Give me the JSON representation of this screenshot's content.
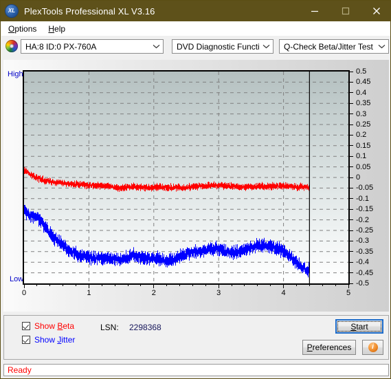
{
  "window": {
    "title": "PlexTools Professional XL V3.16",
    "icon": "XL",
    "icon_name": "plextools-logo-icon",
    "minimize": "minimize-icon",
    "maximize": "maximize-icon",
    "close": "close-icon",
    "titlebar_color": "#5e511a"
  },
  "menu": {
    "items": [
      {
        "label": "Options",
        "accel": "O"
      },
      {
        "label": "Help",
        "accel": "H"
      }
    ]
  },
  "toolbar": {
    "drive_icon": "optical-disc-icon",
    "drive_select": {
      "value": "HA:8 ID:0  PX-760A",
      "options": [
        "HA:8 ID:0  PX-760A"
      ]
    },
    "function_select": {
      "value": "DVD Diagnostic Functions",
      "options": [
        "DVD Diagnostic Functions"
      ]
    },
    "test_select": {
      "value": "Q-Check Beta/Jitter Test",
      "options": [
        "Q-Check Beta/Jitter Test"
      ]
    }
  },
  "chart_data": {
    "type": "line",
    "title": "",
    "xlabel": "",
    "ylabel": "",
    "xlim": [
      0,
      5
    ],
    "ylim": [
      -0.5,
      0.5
    ],
    "xticks": [
      0,
      1,
      2,
      3,
      4,
      5
    ],
    "yticks": [
      0.5,
      0.45,
      0.4,
      0.35,
      0.3,
      0.25,
      0.2,
      0.15,
      0.1,
      0.05,
      0,
      -0.05,
      -0.1,
      -0.15,
      -0.2,
      -0.25,
      -0.3,
      -0.35,
      -0.4,
      -0.45,
      -0.5
    ],
    "ytick_labels": [
      "0.5",
      "0.45",
      "0.4",
      "0.35",
      "0.3",
      "0.25",
      "0.2",
      "0.15",
      "0.1",
      "0.05",
      "0",
      "-0.05",
      "-0.1",
      "-0.15",
      "-0.2",
      "-0.25",
      "-0.3",
      "-0.35",
      "-0.4",
      "-0.45",
      "-0.5"
    ],
    "left_axis_top_label": "High",
    "left_axis_bottom_label": "Low",
    "grid": true,
    "grid_style": "dashed",
    "grid_color": "#808080",
    "plot_bg_gradient_top": "#b4c0c0",
    "plot_bg_gradient_bottom": "#ffffff",
    "data_end_marker_x": 4.4,
    "legend_position": "below-plot",
    "series": [
      {
        "name": "Beta",
        "color": "#ff0000",
        "noise": 0.016,
        "x": [
          0.0,
          0.05,
          0.1,
          0.18,
          0.28,
          0.4,
          0.55,
          0.7,
          0.9,
          1.1,
          1.3,
          1.45,
          1.6,
          1.8,
          2.0,
          2.2,
          2.4,
          2.55,
          2.7,
          2.9,
          3.1,
          3.3,
          3.5,
          3.7,
          3.9,
          4.1,
          4.25,
          4.4
        ],
        "values": [
          0.03,
          0.025,
          0.012,
          0.0,
          -0.01,
          -0.02,
          -0.026,
          -0.03,
          -0.034,
          -0.038,
          -0.042,
          -0.052,
          -0.044,
          -0.046,
          -0.047,
          -0.047,
          -0.047,
          -0.046,
          -0.04,
          -0.038,
          -0.04,
          -0.043,
          -0.043,
          -0.042,
          -0.04,
          -0.044,
          -0.045,
          -0.046
        ]
      },
      {
        "name": "Jitter",
        "color": "#0000ff",
        "noise": 0.03,
        "x": [
          0.0,
          0.05,
          0.1,
          0.15,
          0.22,
          0.3,
          0.38,
          0.45,
          0.52,
          0.6,
          0.7,
          0.8,
          0.9,
          1.0,
          1.1,
          1.2,
          1.3,
          1.4,
          1.5,
          1.6,
          1.7,
          1.8,
          1.9,
          2.0,
          2.1,
          2.2,
          2.3,
          2.4,
          2.5,
          2.6,
          2.7,
          2.8,
          2.9,
          3.0,
          3.1,
          3.2,
          3.3,
          3.4,
          3.5,
          3.6,
          3.7,
          3.8,
          3.9,
          4.0,
          4.1,
          4.2,
          4.3,
          4.38,
          4.4
        ],
        "values": [
          -0.15,
          -0.17,
          -0.18,
          -0.185,
          -0.195,
          -0.225,
          -0.258,
          -0.285,
          -0.3,
          -0.32,
          -0.345,
          -0.36,
          -0.372,
          -0.378,
          -0.38,
          -0.383,
          -0.378,
          -0.382,
          -0.388,
          -0.378,
          -0.368,
          -0.378,
          -0.385,
          -0.38,
          -0.384,
          -0.395,
          -0.39,
          -0.372,
          -0.36,
          -0.352,
          -0.348,
          -0.34,
          -0.336,
          -0.34,
          -0.35,
          -0.358,
          -0.352,
          -0.342,
          -0.33,
          -0.322,
          -0.32,
          -0.326,
          -0.336,
          -0.352,
          -0.372,
          -0.398,
          -0.425,
          -0.445,
          -0.39
        ]
      }
    ]
  },
  "controls": {
    "show_beta": {
      "label_prefix": "Show ",
      "label_accel": "B",
      "label_rest": "eta",
      "checked": true,
      "color": "#ff0000"
    },
    "show_jitter": {
      "label_prefix": "Show ",
      "label_accel": "J",
      "label_rest": "itter",
      "checked": true,
      "color": "#0000ff"
    },
    "lsn_label": "LSN:",
    "lsn_value": "2298368",
    "start_button": {
      "prefix": "",
      "accel": "S",
      "rest": "tart",
      "focused": true
    },
    "preferences_button": {
      "prefix": "",
      "accel": "P",
      "rest": "references"
    },
    "info_button": {
      "icon": "info-icon",
      "glyph": "i"
    }
  },
  "status": {
    "text": "Ready",
    "color": "#ff0000"
  }
}
